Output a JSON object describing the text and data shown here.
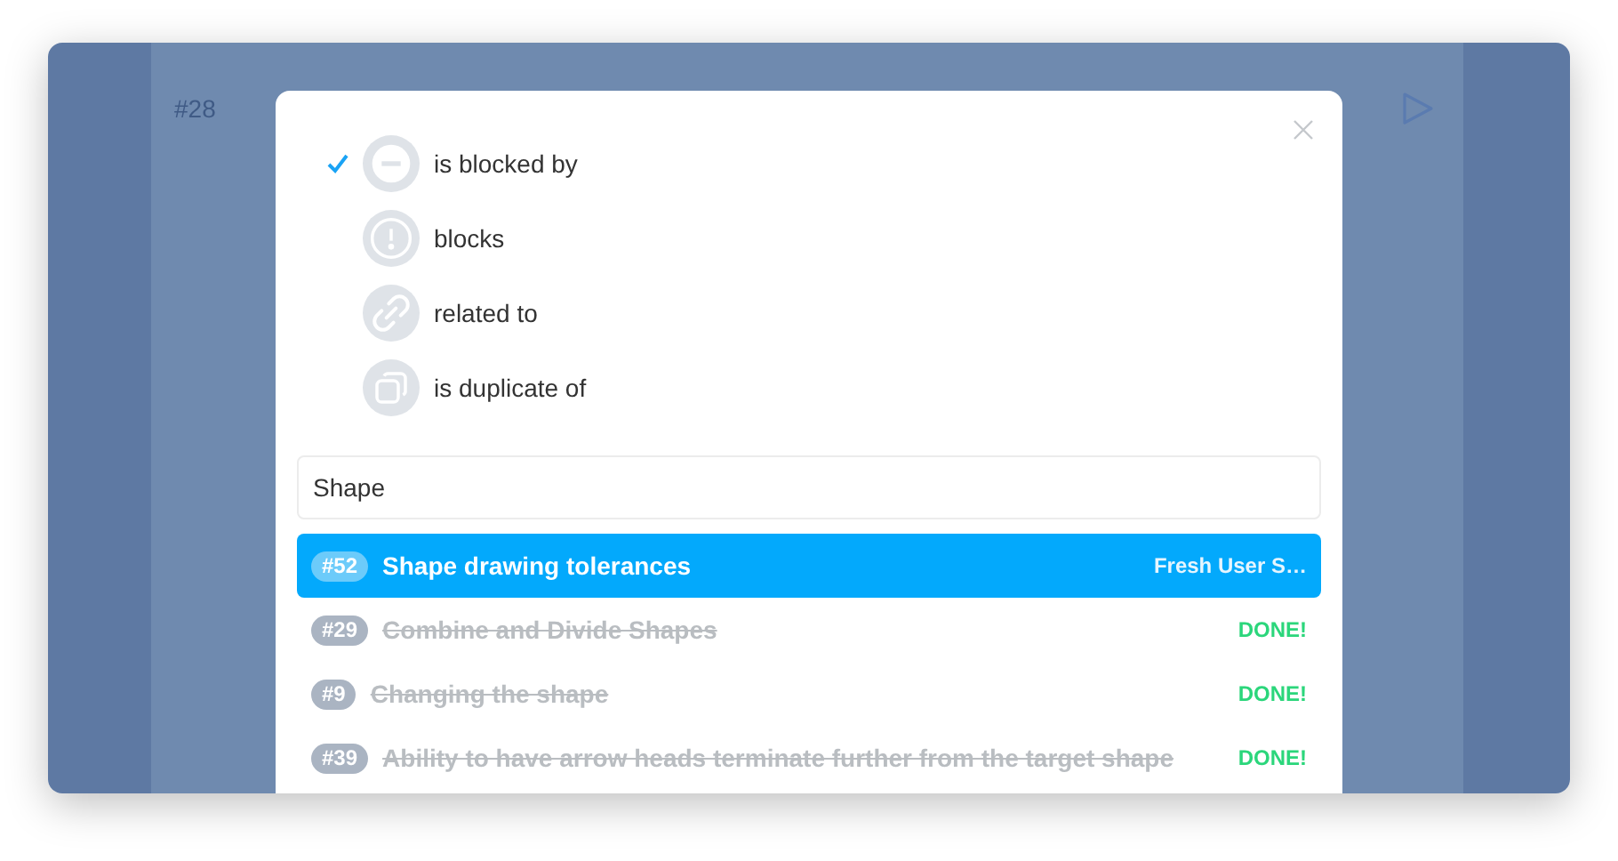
{
  "background": {
    "issue_number": "#28"
  },
  "relation_types": [
    {
      "kind": "blocked_by",
      "label": "is blocked by",
      "selected": true
    },
    {
      "kind": "blocks",
      "label": "blocks",
      "selected": false
    },
    {
      "kind": "related",
      "label": "related to",
      "selected": false
    },
    {
      "kind": "duplicate",
      "label": "is duplicate of",
      "selected": false
    }
  ],
  "search": {
    "value": "Shape"
  },
  "results": [
    {
      "number": "#52",
      "title": "Shape drawing tolerances",
      "status": "Fresh User S…",
      "done": false,
      "selected": true
    },
    {
      "number": "#29",
      "title": "Combine and Divide Shapes",
      "status": "DONE!",
      "done": true,
      "selected": false
    },
    {
      "number": "#9",
      "title": "Changing the shape",
      "status": "DONE!",
      "done": true,
      "selected": false
    },
    {
      "number": "#39",
      "title": "Ability to have arrow heads terminate further from the target shape",
      "status": "DONE!",
      "done": true,
      "selected": false
    }
  ]
}
